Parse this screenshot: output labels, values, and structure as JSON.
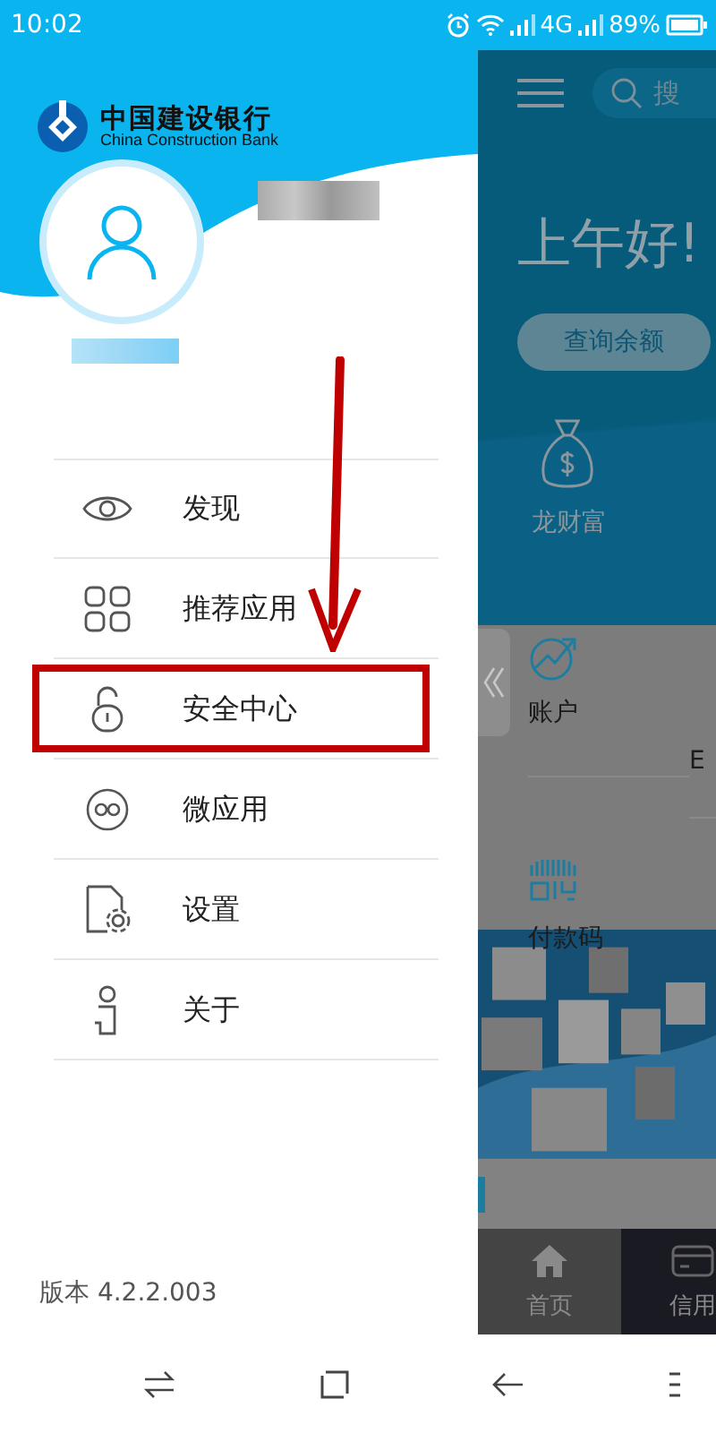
{
  "status_bar": {
    "time": "10:02",
    "network": "4G",
    "battery": "89%"
  },
  "drawer": {
    "bank_name": "中国建设银行",
    "bank_name_en": "China Construction Bank",
    "menu": [
      {
        "label": "发现",
        "kind": "eye",
        "highlighted": false
      },
      {
        "label": "推荐应用",
        "kind": "apps",
        "highlighted": false
      },
      {
        "label": "安全中心",
        "kind": "lock",
        "highlighted": true
      },
      {
        "label": "微应用",
        "kind": "infinity",
        "highlighted": false
      },
      {
        "label": "设置",
        "kind": "settings",
        "highlighted": false
      },
      {
        "label": "关于",
        "kind": "info",
        "highlighted": false
      }
    ],
    "version": "版本 4.2.2.003"
  },
  "home": {
    "search_placeholder": "搜",
    "greeting": "上午好!",
    "balance_button": "查询余额",
    "wealth_label": "龙财富",
    "shortcuts": [
      {
        "label": "账户",
        "kind": "chart"
      },
      {
        "label": "E",
        "kind": "none"
      },
      {
        "label": "付款码",
        "kind": "code"
      }
    ],
    "tabs": [
      {
        "label": "首页",
        "kind": "home",
        "selected": true
      },
      {
        "label": "信用",
        "kind": "card",
        "selected": false
      }
    ]
  }
}
